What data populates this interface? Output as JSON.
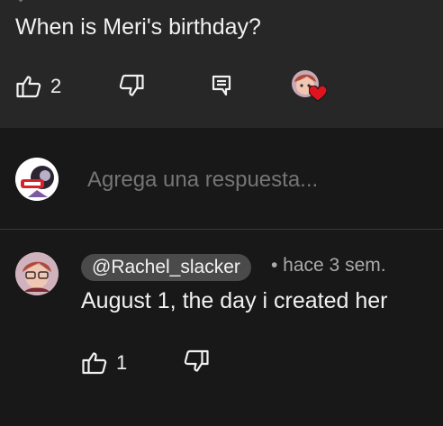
{
  "top_comment": {
    "text": "When is Meri's birthday?",
    "like_count": "2"
  },
  "reply_box": {
    "placeholder": "Agrega una respuesta..."
  },
  "reply": {
    "author": "@Rachel_slacker",
    "meta": "• hace 3 sem.",
    "text": "August 1, the day i created her",
    "like_count": "1"
  },
  "colors": {
    "background": "#0f0f0f",
    "top_comment_bg": "#272727",
    "reply_bg": "#181818",
    "author_chip_bg": "#4a4a4a",
    "heart": "#e0141e"
  },
  "icons": {
    "like": "thumbs-up-icon",
    "dislike": "thumbs-down-icon",
    "reply": "comment-reply-icon",
    "creator_heart": "creator-heart-icon"
  }
}
